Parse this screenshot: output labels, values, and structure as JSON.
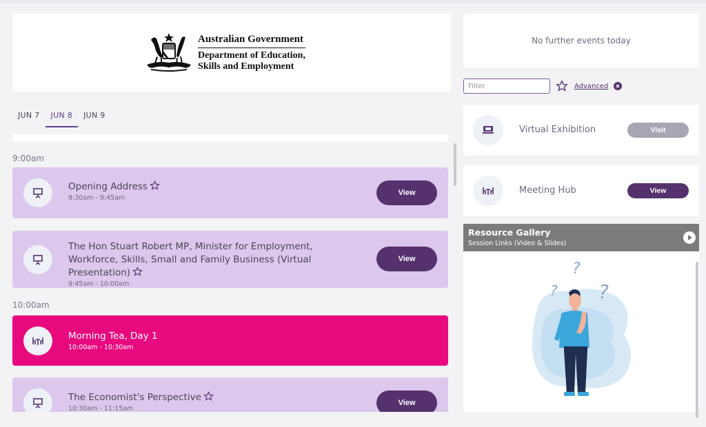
{
  "logo": {
    "line1": "Australian Government",
    "line2": "Department of Education,",
    "line3": "Skills and Employment"
  },
  "date_tabs": [
    {
      "label": "JUN 7",
      "active": false
    },
    {
      "label": "JUN 8",
      "active": true
    },
    {
      "label": "JUN 9",
      "active": false
    }
  ],
  "schedule": {
    "time_labels": [
      "9:00am",
      "10:00am"
    ],
    "sessions": [
      {
        "title": "Opening Address",
        "time": "9:30am - 9:45am",
        "button": "View",
        "icon": "presentation-icon"
      },
      {
        "title": "The Hon Stuart Robert MP, Minister for Employment, Workforce, Skills, Small and Family Business (Virtual Presentation)",
        "time": "9:45am - 10:00am",
        "button": "View",
        "icon": "presentation-icon"
      },
      {
        "title": "Morning Tea, Day 1",
        "time": "10:00am - 10:30am",
        "icon": "meeting-table-icon"
      },
      {
        "title": "The Economist's Perspective",
        "time": "10:30am - 11:15am",
        "button": "View",
        "icon": "presentation-icon"
      }
    ]
  },
  "sidebar": {
    "no_events": "No further events today",
    "filter_placeholder": "Filter",
    "advanced_label": "Advanced",
    "features": [
      {
        "label": "Virtual Exhibition",
        "button": "Visit",
        "icon": "exhibition-booth-icon"
      },
      {
        "label": "Meeting Hub",
        "button": "View",
        "icon": "meeting-table-icon"
      }
    ],
    "gallery": {
      "title": "Resource Gallery",
      "subtitle": "Session Links (Video & Slides)"
    }
  },
  "colors": {
    "accent": "#55326e",
    "session_bg": "#dcc8ec",
    "highlight": "#e8097e"
  }
}
